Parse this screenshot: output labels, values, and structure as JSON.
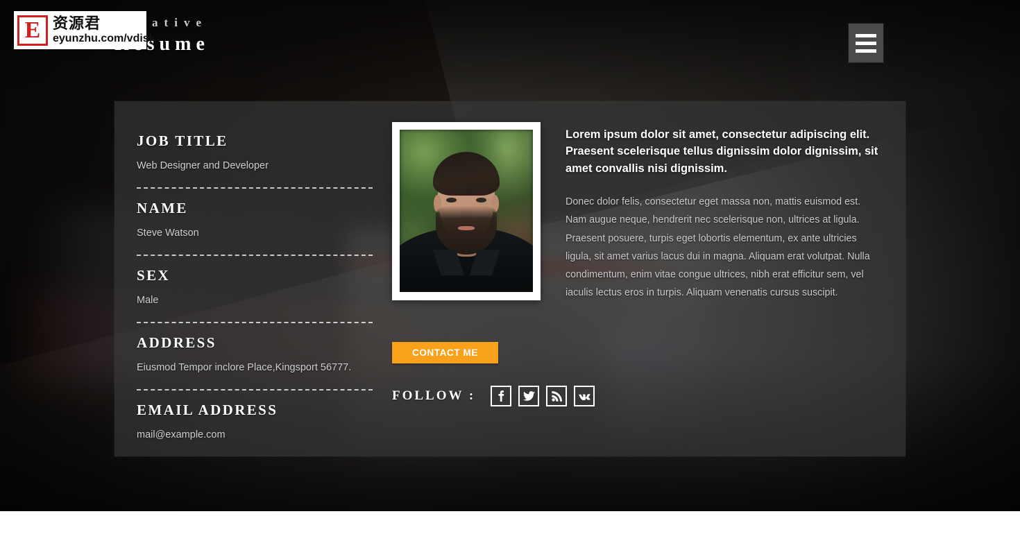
{
  "header": {
    "brand_line1": "Creative",
    "brand_line2": "Resume",
    "menu_label": "menu-toggle"
  },
  "watermark": {
    "badge": "E",
    "chinese": "资源君",
    "url": "eyunzhu.com/vdisk"
  },
  "card": {
    "info": [
      {
        "label": "JOB TITLE",
        "value": "Web Designer and Developer"
      },
      {
        "label": "NAME",
        "value": "Steve Watson"
      },
      {
        "label": "SEX",
        "value": "Male"
      },
      {
        "label": "ADDRESS",
        "value": "Eiusmod Tempor inclore Place,Kingsport 56777."
      },
      {
        "label": "EMAIL ADDRESS",
        "value": "mail@example.com"
      }
    ],
    "photo_alt": "portrait-photo",
    "cta_label": "CONTACT ME",
    "follow_label": "FOLLOW :",
    "social": [
      {
        "name": "facebook",
        "glyph": "f"
      },
      {
        "name": "twitter",
        "glyph": "twitter-bird"
      },
      {
        "name": "rss",
        "glyph": "rss-waves"
      },
      {
        "name": "vk",
        "glyph": "vk"
      }
    ],
    "lead": "Lorem ipsum dolor sit amet, consectetur adipiscing elit. Praesent scelerisque tellus dignissim dolor dignissim, sit amet convallis nisi dignissim.",
    "body": "Donec dolor felis, consectetur eget massa non, mattis euismod est. Nam augue neque, hendrerit nec scelerisque non, ultrices at ligula. Praesent posuere, turpis eget lobortis elementum, ex ante ultricies ligula, sit amet varius lacus dui in magna. Aliquam erat volutpat. Nulla condimentum, enim vitae congue ultrices, nibh erat efficitur sem, vel iaculis lectus eros in turpis. Aliquam venenatis cursus suscipit."
  },
  "colors": {
    "accent": "#f9a11b",
    "card_overlay": "rgba(58,60,60,0.62)",
    "text_primary": "#ffffff",
    "text_muted": "#c9c9c9",
    "watermark_red": "#cf1f1f"
  }
}
